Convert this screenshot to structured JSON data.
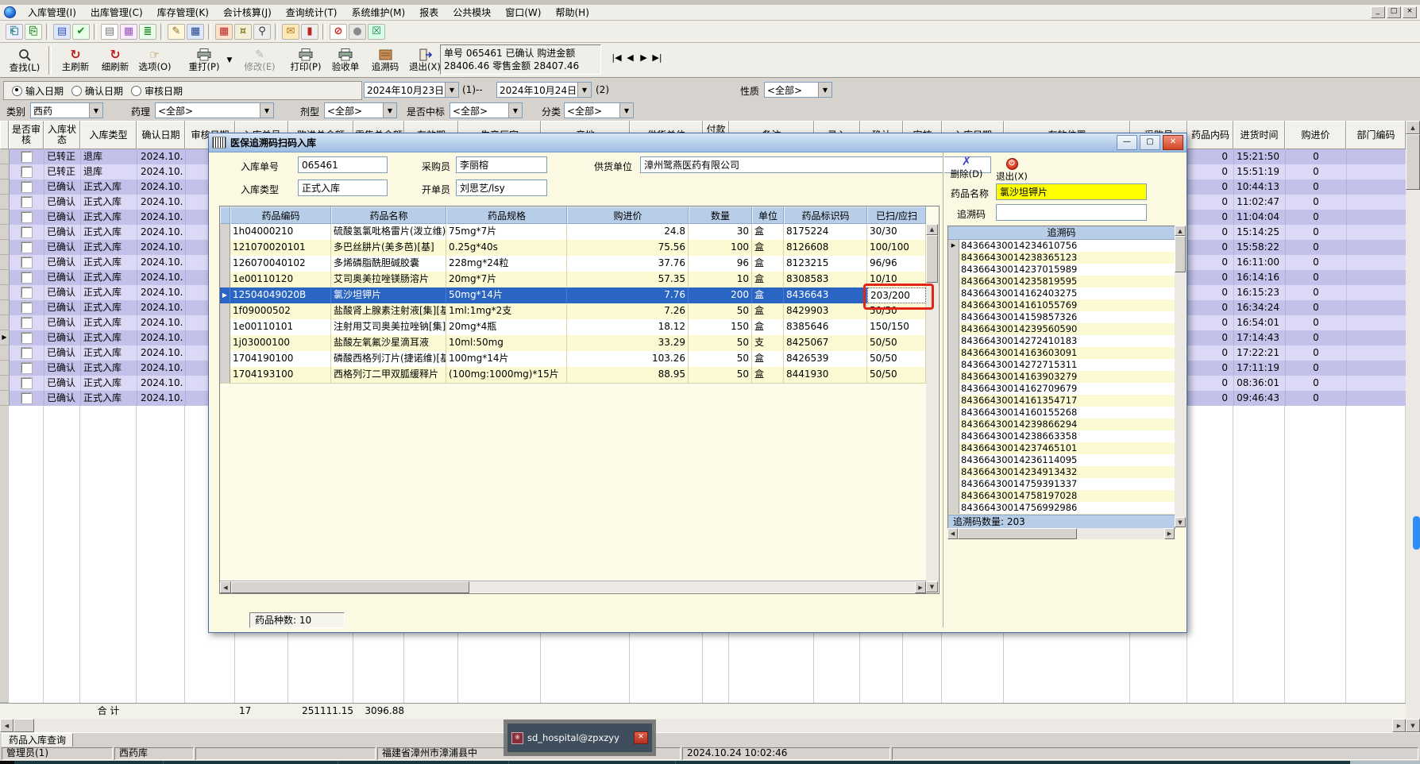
{
  "window": {
    "min": "_",
    "max": "□",
    "close": "×"
  },
  "menu": {
    "items": [
      "入库管理(I)",
      "出库管理(C)",
      "库存管理(K)",
      "会计核算(J)",
      "查询统计(T)",
      "系统维护(M)",
      "报表",
      "公共模块",
      "窗口(W)",
      "帮助(H)"
    ]
  },
  "toolbar_small": {
    "icons": [
      "open-page-icon",
      "copy-page-icon",
      "clipboard-icon",
      "confirm-check-icon",
      "note-icon",
      "chart-icon",
      "list-icon",
      "write-book-icon",
      "ledger-icon",
      "calendar-icon",
      "audit-icon",
      "search-icon",
      "mail-folder-icon",
      "probe-icon",
      "forbidden-icon",
      "sphere-icon",
      "close-box-icon"
    ]
  },
  "toolbar": {
    "buttons": [
      {
        "label": "查找(L)"
      },
      {
        "label": "主刷新"
      },
      {
        "label": "细刷新"
      },
      {
        "label": "选项(O)"
      },
      {
        "label": "重打(P)"
      },
      {
        "label": "修改(E)"
      },
      {
        "label": "打印(P)"
      },
      {
        "label": "验收单"
      },
      {
        "label": "追溯码"
      },
      {
        "label": "退出(X)"
      }
    ],
    "dropdown_arrow": "▼",
    "info_line1": "单号 065461 已确认 购进金额",
    "info_line2": "28406.46 零售金额 28407.46",
    "nav": [
      "|◀",
      "◀",
      "▶",
      "▶|"
    ]
  },
  "filters": {
    "radios": [
      "输入日期",
      "确认日期",
      "审核日期"
    ],
    "date_from": "2024年10月23日",
    "between_label": "(1)--",
    "date_to": "2024年10月24日",
    "after_label": "(2)",
    "nature_label": "性质",
    "nature_value": "<全部>",
    "category_label": "类别",
    "category_value": "西药",
    "pharmacology_label": "药理",
    "pharmacology_value": "<全部>",
    "dosage_label": "剂型",
    "dosage_value": "<全部>",
    "bid_label": "是否中标",
    "bid_value": "<全部>",
    "class_label": "分类",
    "class_value": "<全部>"
  },
  "main_table": {
    "columns": [
      "是否审核",
      "入库状态",
      "入库类型",
      "确认日期",
      "审核日期",
      "入库单号",
      "购进总金额",
      "零售总金额",
      "有效期",
      "生产厂家",
      "产地",
      "供货单位",
      "付款方式",
      "备注",
      "录入",
      "确认",
      "审核",
      "入库日期",
      "存放位置",
      "采购员",
      "药品内码",
      "进货时间",
      "购进价",
      "部门编码"
    ],
    "rows": [
      {
        "status": "已转正",
        "type": "退库",
        "date": "2024.10.",
        "inner_code": "0",
        "time": "15:21:50",
        "price": "0"
      },
      {
        "status": "已转正",
        "type": "退库",
        "date": "2024.10.",
        "inner_code": "0",
        "time": "15:51:19",
        "price": "0"
      },
      {
        "status": "已确认",
        "type": "正式入库",
        "date": "2024.10.",
        "inner_code": "0",
        "time": "10:44:13",
        "price": "0"
      },
      {
        "status": "已确认",
        "type": "正式入库",
        "date": "2024.10.",
        "inner_code": "0",
        "time": "11:02:47",
        "price": "0"
      },
      {
        "status": "已确认",
        "type": "正式入库",
        "date": "2024.10.",
        "inner_code": "0",
        "time": "11:04:04",
        "price": "0"
      },
      {
        "status": "已确认",
        "type": "正式入库",
        "date": "2024.10.",
        "inner_code": "0",
        "time": "15:14:25",
        "price": "0"
      },
      {
        "status": "已确认",
        "type": "正式入库",
        "date": "2024.10.",
        "inner_code": "0",
        "time": "15:58:22",
        "price": "0"
      },
      {
        "status": "已确认",
        "type": "正式入库",
        "date": "2024.10.",
        "inner_code": "0",
        "time": "16:11:00",
        "price": "0"
      },
      {
        "status": "已确认",
        "type": "正式入库",
        "date": "2024.10.",
        "inner_code": "0",
        "time": "16:14:16",
        "price": "0"
      },
      {
        "status": "已确认",
        "type": "正式入库",
        "date": "2024.10.",
        "inner_code": "0",
        "time": "16:15:23",
        "price": "0"
      },
      {
        "status": "已确认",
        "type": "正式入库",
        "date": "2024.10.",
        "inner_code": "0",
        "time": "16:34:24",
        "price": "0"
      },
      {
        "status": "已确认",
        "type": "正式入库",
        "date": "2024.10.",
        "inner_code": "0",
        "time": "16:54:01",
        "price": "0"
      },
      {
        "status": "已确认",
        "type": "正式入库",
        "date": "2024.10.",
        "inner_code": "0",
        "time": "17:14:43",
        "price": "0"
      },
      {
        "status": "已确认",
        "type": "正式入库",
        "date": "2024.10.",
        "inner_code": "0",
        "time": "17:22:21",
        "price": "0"
      },
      {
        "status": "已确认",
        "type": "正式入库",
        "date": "2024.10.",
        "inner_code": "0",
        "time": "17:11:19",
        "price": "0"
      },
      {
        "status": "已确认",
        "type": "正式入库",
        "date": "2024.10.",
        "inner_code": "0",
        "time": "08:36:01",
        "price": "0"
      },
      {
        "status": "已确认",
        "type": "正式入库",
        "date": "2024.10.",
        "inner_code": "0",
        "time": "09:46:43",
        "price": "0"
      }
    ],
    "footer": {
      "label": "合  计",
      "count": "17",
      "total_purchase": "251111.15",
      "total_retail": "3096.88"
    }
  },
  "dialog": {
    "title": "医保追溯码扫码入库",
    "fields": [
      {
        "label": "入库单号",
        "value": "065461"
      },
      {
        "label": "采购员",
        "value": "李丽榕"
      },
      {
        "label": "供货单位",
        "value": "漳州鹭燕医药有限公司"
      },
      {
        "label": "入库类型",
        "value": "正式入库"
      },
      {
        "label": "开单员",
        "value": "刘思艺/lsy"
      }
    ],
    "table": {
      "columns": [
        "药品编码",
        "药品名称",
        "药品规格",
        "购进价",
        "数量",
        "单位",
        "药品标识码",
        "已扫/应扫"
      ],
      "rows": [
        [
          "1h04000210",
          "硫酸氢氯吡格雷片(泼立维)[",
          "75mg*7片",
          "24.8",
          "30",
          "盒",
          "8175224",
          "30/30"
        ],
        [
          "121070020101",
          "多巴丝肼片(美多芭)[基]",
          "0.25g*40s",
          "75.56",
          "100",
          "盒",
          "8126608",
          "100/100"
        ],
        [
          "126070040102",
          "多烯磷脂酰胆碱胶囊",
          "228mg*24粒",
          "37.76",
          "96",
          "盒",
          "8123215",
          "96/96"
        ],
        [
          "1e00110120",
          "艾司奥美拉唑镁肠溶片",
          "20mg*7片",
          "57.35",
          "10",
          "盒",
          "8308583",
          "10/10"
        ],
        [
          "12504049020B",
          "氯沙坦钾片",
          "50mg*14片",
          "7.76",
          "200",
          "盒",
          "8436643",
          "203/200"
        ],
        [
          "1f09000502",
          "盐酸肾上腺素注射液[集][基",
          "1ml:1mg*2支",
          "7.26",
          "50",
          "盒",
          "8429903",
          "50/50"
        ],
        [
          "1e00110101",
          "注射用艾司奥美拉唑钠[集]",
          "20mg*4瓶",
          "18.12",
          "150",
          "盒",
          "8385646",
          "150/150"
        ],
        [
          "1j03000100",
          "盐酸左氧氟沙星滴耳液",
          "10ml:50mg",
          "33.29",
          "50",
          "支",
          "8425067",
          "50/50"
        ],
        [
          "1704190100",
          "磷酸西格列汀片(捷诺维)[基",
          "100mg*14片",
          "103.26",
          "50",
          "盒",
          "8426539",
          "50/50"
        ],
        [
          "1704193100",
          "西格列汀二甲双胍缓释片",
          "(100mg:1000mg)*15片",
          "88.95",
          "50",
          "盒",
          "8441930",
          "50/50"
        ]
      ],
      "selected_row_index": 4
    },
    "drug_count_label": "药品种数: 10"
  },
  "trace_panel": {
    "delete_label": "删除(D)",
    "exit_label": "退出(X)",
    "drug_name_label": "药品名称",
    "drug_name": "氯沙坦钾片",
    "trace_label": "追溯码",
    "trace_input": "",
    "list_header": "追溯码",
    "codes": [
      "84366430014234610756",
      "84366430014238365123",
      "84366430014237015989",
      "84366430014235819595",
      "84366430014162403275",
      "84366430014161055769",
      "84366430014159857326",
      "84366430014239560590",
      "84366430014272410183",
      "84366430014163603091",
      "84366430014272715311",
      "84366430014163903279",
      "84366430014162709679",
      "84366430014161354717",
      "84366430014160155268",
      "84366430014239866294",
      "84366430014238663358",
      "84366430014237465101",
      "84366430014236114095",
      "84366430014234913432",
      "84366430014759391337",
      "84366430014758197028",
      "84366430014756992986"
    ],
    "count_label": "追溯码数量: 203"
  },
  "bottom": {
    "tab": "药品入库查询",
    "status_user": "管理员(1)",
    "status_store": "西药库",
    "status_location": "福建省漳州市漳浦县中",
    "status_datetime": "2024.10.24 10:02:46",
    "floating_title": "sd_hospital@zpxzyy"
  }
}
